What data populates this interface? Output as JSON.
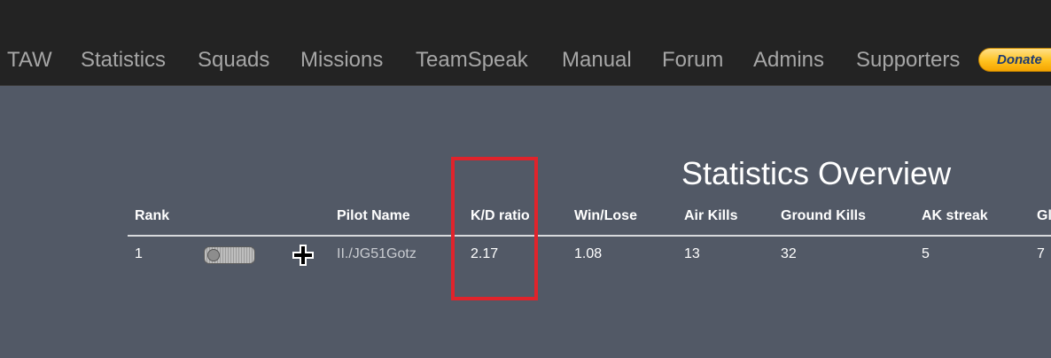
{
  "nav": {
    "items": [
      "TAW",
      "Statistics",
      "Squads",
      "Missions",
      "TeamSpeak",
      "Manual",
      "Forum",
      "Admins",
      "Supporters"
    ],
    "donate_label": "Donate"
  },
  "page": {
    "title": "Statistics Overview"
  },
  "table": {
    "headers": [
      "Rank",
      "Pilot Name",
      "K/D ratio",
      "Win/Lose",
      "Air Kills",
      "Ground Kills",
      "AK streak",
      "Gl"
    ],
    "rows": [
      {
        "rank": "1",
        "rank_icon": "rank-insignia-icon",
        "faction_icon": "balkenkreuz-icon",
        "pilot": "II./JG51Gotz",
        "kd": "2.17",
        "winlose": "1.08",
        "air_kills": "13",
        "ground_kills": "32",
        "ak_streak": "5",
        "gk": "7"
      }
    ]
  },
  "colors": {
    "background": "#525966",
    "navbar": "#232323",
    "highlight": "#e0232b",
    "donate": "#ffc21f"
  }
}
